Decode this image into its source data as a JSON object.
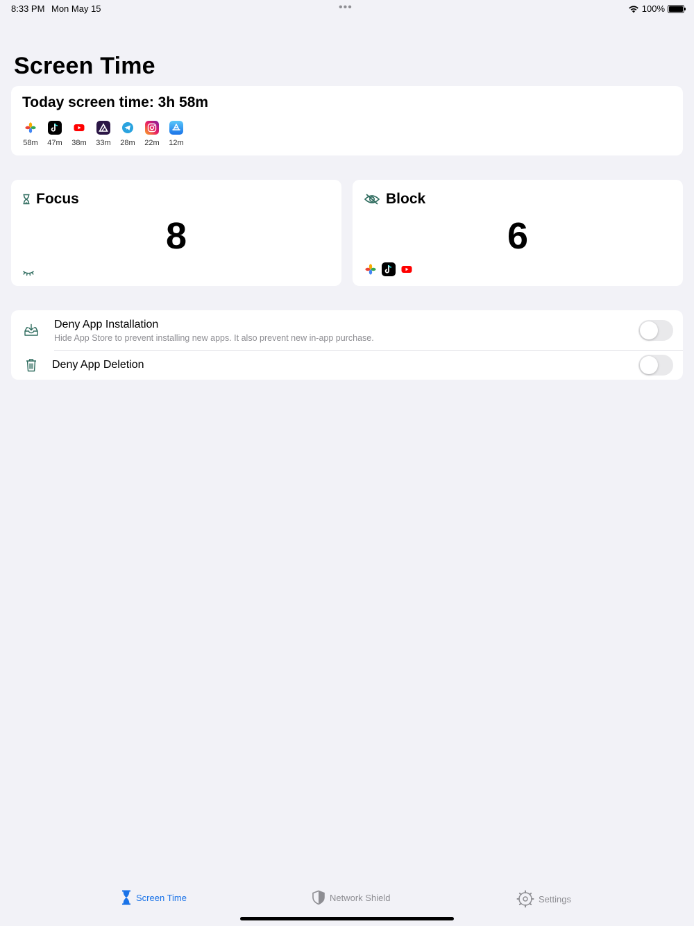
{
  "status_bar": {
    "time": "8:33 PM",
    "date": "Mon May 15",
    "battery": "100%"
  },
  "page": {
    "title": "Screen Time"
  },
  "today": {
    "title": "Today screen time: 3h 58m",
    "apps": [
      {
        "icon": "photos-icon",
        "time": "58m"
      },
      {
        "icon": "tiktok-icon",
        "time": "47m"
      },
      {
        "icon": "youtube-icon",
        "time": "38m"
      },
      {
        "icon": "affinity-icon",
        "time": "33m"
      },
      {
        "icon": "telegram-icon",
        "time": "28m"
      },
      {
        "icon": "instagram-icon",
        "time": "22m"
      },
      {
        "icon": "appstore-icon",
        "time": "12m"
      }
    ]
  },
  "focus": {
    "label": "Focus",
    "count": "8"
  },
  "block": {
    "label": "Block",
    "count": "6"
  },
  "settings": {
    "deny_install": {
      "title": "Deny App Installation",
      "subtitle": "Hide App Store to prevent installing new apps. It also prevent new in-app purchase.",
      "enabled": false
    },
    "deny_delete": {
      "title": "Deny App Deletion",
      "enabled": false
    }
  },
  "tabs": [
    {
      "label": "Screen Time",
      "active": true
    },
    {
      "label": "Network Shield",
      "active": false
    },
    {
      "label": "Settings",
      "active": false
    }
  ],
  "colors": {
    "accent": "#1a73e8",
    "icon_green": "#2e6b5e",
    "background": "#f2f2f7"
  }
}
